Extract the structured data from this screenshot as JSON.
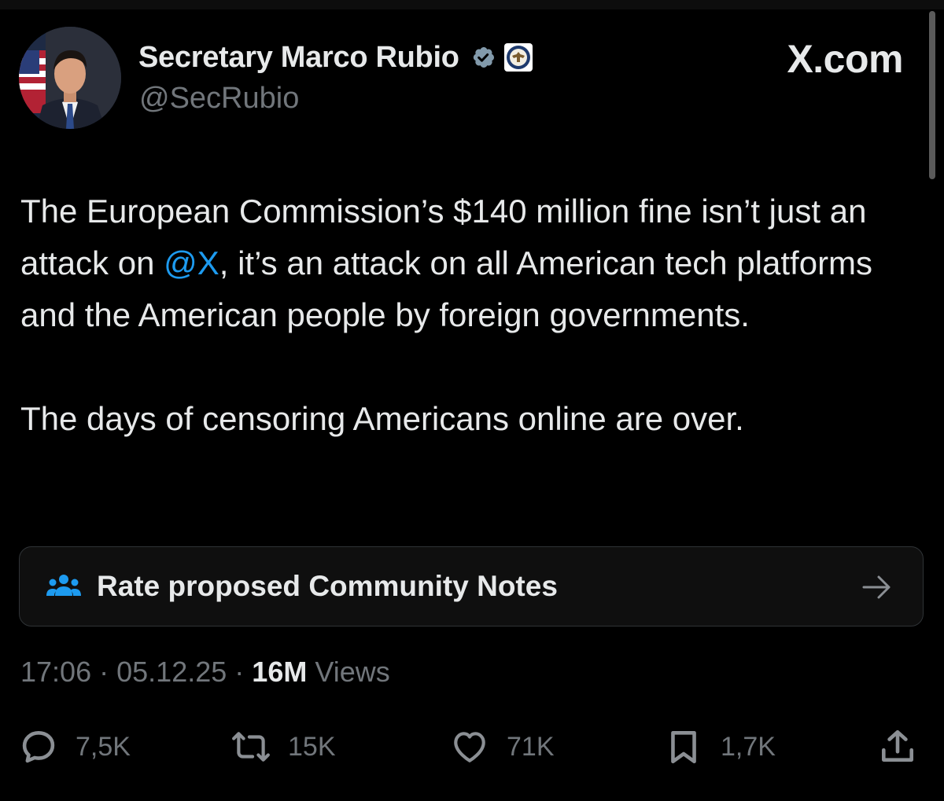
{
  "author": {
    "name": "Secretary Marco Rubio",
    "handle": "@SecRubio"
  },
  "brand": "X.com",
  "tweet": {
    "paragraph1_before": "The European Commission’s $140 million fine isn’t just an attack on ",
    "mention": "@X",
    "paragraph1_after": ", it’s an attack on all American tech platforms and the American people by foreign governments.",
    "paragraph2": "The days of censoring Americans online are over."
  },
  "community_notes": {
    "label": "Rate proposed Community Notes",
    "icon": "people-icon"
  },
  "meta": {
    "time": "17:06",
    "date": "05.12.25",
    "separator": "·",
    "views_count": "16M",
    "views_label": "Views"
  },
  "actions": {
    "replies": "7,5K",
    "reposts": "15K",
    "likes": "71K",
    "bookmarks": "1,7K"
  },
  "colors": {
    "background": "#000000",
    "text": "#e7e9ea",
    "muted": "#71767b",
    "link": "#1d9bf0",
    "verified": "#829aab"
  }
}
